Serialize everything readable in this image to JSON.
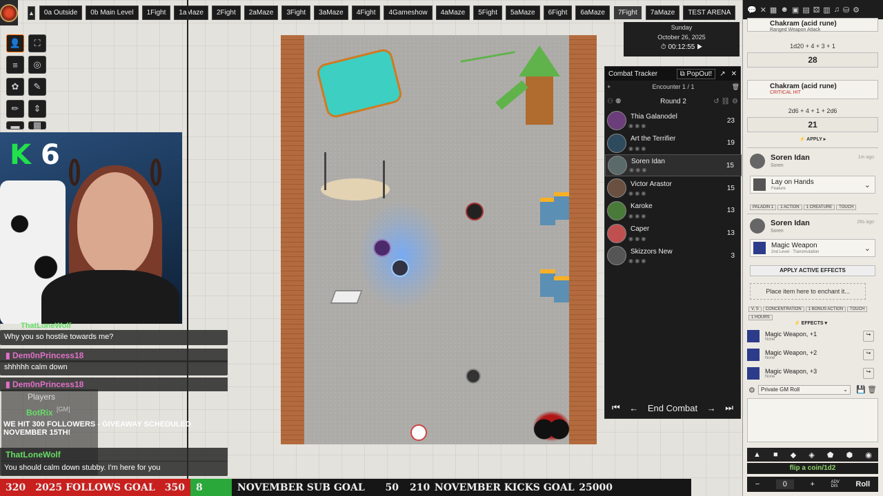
{
  "scene_bar": {
    "tabs": [
      {
        "label": "0a Outside"
      },
      {
        "label": "0b Main Level"
      },
      {
        "label": "1Fight"
      },
      {
        "label": "1aMaze"
      },
      {
        "label": "2Fight"
      },
      {
        "label": "2aMaze"
      },
      {
        "label": "3Fight"
      },
      {
        "label": "3aMaze"
      },
      {
        "label": "4Fight"
      },
      {
        "label": "4Gameshow"
      },
      {
        "label": "4aMaze"
      },
      {
        "label": "5Fight"
      },
      {
        "label": "5aMaze"
      },
      {
        "label": "6Fight"
      },
      {
        "label": "6aMaze"
      },
      {
        "label": "7Fight"
      },
      {
        "label": "7aMaze"
      },
      {
        "label": "TEST ARENA"
      }
    ],
    "active": "7Fight"
  },
  "webcam": {
    "letter": "K",
    "count": "6"
  },
  "chat": {
    "top_name": "ThatLoneWolf",
    "messages": [
      {
        "text": "Why you so hostile towards me?"
      },
      {
        "name": "Dem0nPrincess18",
        "text": "shhhhh calm down"
      },
      {
        "name": "Dem0nPrincess18"
      },
      {
        "name": "BotRix",
        "text": "WE HIT 300 FOLLOWERS - GIVEAWAY SCHEDULED NOVEMBER 15TH!"
      },
      {
        "name": "ThatLoneWolf",
        "text": "You should calm down stubby. I'm here for you"
      }
    ],
    "players_title": "Players",
    "gm_label": "[GM]"
  },
  "date": {
    "weekday": "Sunday",
    "date": "October 26, 2025",
    "time": "00:12:55"
  },
  "tracker": {
    "title": "Combat Tracker",
    "popout": "PopOut!",
    "encounter": "Encounter 1 / 1",
    "round": "Round 2",
    "combatants": [
      {
        "name": "Thia Galanodel",
        "init": "23",
        "color": "#6b3d7a"
      },
      {
        "name": "Art the Terrifier",
        "init": "19",
        "color": "#2e4b5e"
      },
      {
        "name": "Soren Idan",
        "init": "15",
        "color": "#5a6a6a"
      },
      {
        "name": "Victor Arastor",
        "init": "15",
        "color": "#6a5040"
      },
      {
        "name": "Karoke",
        "init": "13",
        "color": "#4a7a3a"
      },
      {
        "name": "Caper",
        "init": "13",
        "color": "#c05050"
      },
      {
        "name": "Skizzors New",
        "init": "3",
        "color": "#555555"
      }
    ],
    "active_index": 2,
    "end_label": "End Combat"
  },
  "sidebar": {
    "card1": {
      "title": "Chakram (acid rune)",
      "sub": "Ranged Weapon Attack"
    },
    "roll1": {
      "formula": "1d20 + 4 + 3 + 1",
      "total": "28"
    },
    "card2": {
      "title": "Chakram (acid rune)",
      "sub": "CRITICAL HIT"
    },
    "roll2": {
      "formula": "2d6 + 4 + 1 + 2d6",
      "total": "21"
    },
    "apply": "APPLY",
    "msg1": {
      "speaker": "Soren Idan",
      "sub": "Soren",
      "time": "1m ago",
      "item": "Lay on Hands",
      "item_type": "Feature",
      "tags": [
        "PALADIN 1",
        "1 ACTION",
        "1 CREATURE",
        "TOUCH"
      ]
    },
    "msg2": {
      "speaker": "Soren Idan",
      "sub": "Soren",
      "time": "28s ago",
      "item": "Magic Weapon",
      "item_type": "2nd Level · Transmutation",
      "apply_effects": "APPLY ACTIVE EFFECTS",
      "enchant": "Place item here to enchant it...",
      "tags": [
        "V, S",
        "CONCENTRATION",
        "1 BONUS ACTION",
        "TOUCH",
        "1 HOURS"
      ],
      "effects_label": "EFFECTS",
      "effects": [
        {
          "name": "Magic Weapon, +1",
          "sub": "None"
        },
        {
          "name": "Magic Weapon, +2",
          "sub": "None"
        },
        {
          "name": "Magic Weapon, +3",
          "sub": "None"
        }
      ]
    },
    "roll_mode": "Private GM Roll",
    "flip": "flip a coin/1d2",
    "dice_count": "0",
    "roll_btn": "Roll"
  },
  "bottom_bar": {
    "follows_current": "320",
    "follows_label": "2025 FOLLOWS GOAL",
    "follows_target": "350",
    "sub_current": "8",
    "sub_label": "NOVEMBER SUB GOAL",
    "sub_target": "50",
    "kicks_current": "210",
    "kicks_label": "NOVEMBER KICKS GOAL",
    "kicks_target": "25000"
  },
  "colors": {
    "accent": "#ff6400",
    "follows_bar": "#c8201e",
    "sub_bar": "#2aa83a",
    "kicks_bar": "#222222"
  }
}
